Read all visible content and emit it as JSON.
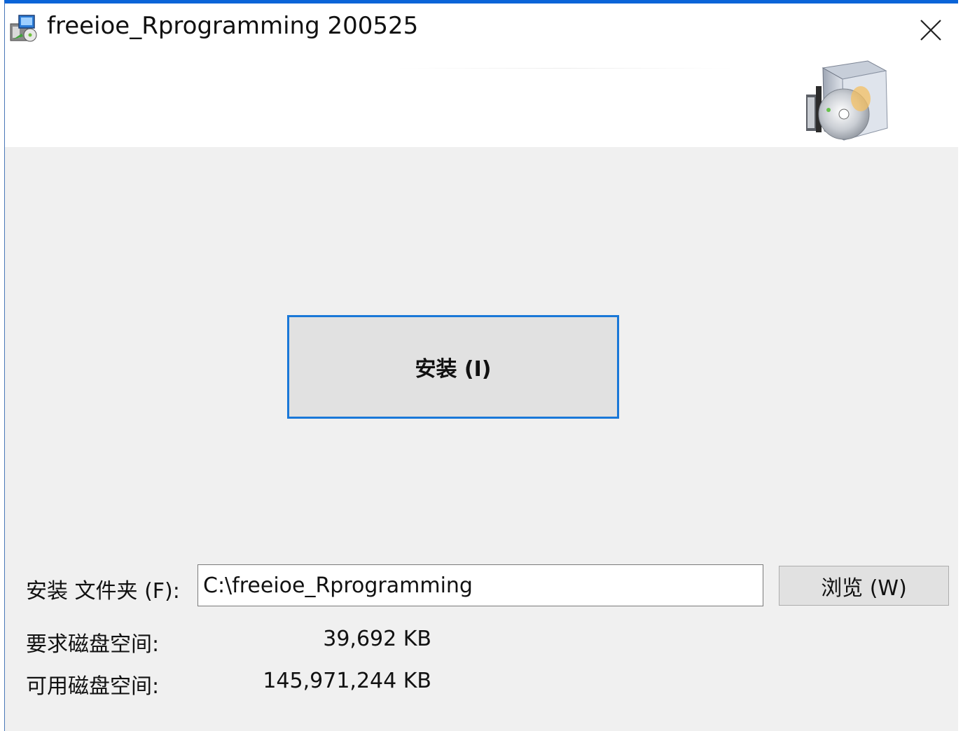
{
  "window": {
    "title": "freeioe_Rprogramming 200525",
    "app_icon": "installer-package-icon",
    "close_icon": "close-icon",
    "banner_image": "software-box-cd-icon"
  },
  "main": {
    "install_button_label": "安装 (I)"
  },
  "footer": {
    "folder_label": "安装 文件夹 (F):",
    "folder_path": "C:\\freeioe_Rprogramming",
    "browse_label": "浏览 (W)",
    "required_label": "要求磁盘空间:",
    "required_value": "39,692 KB",
    "available_label": "可用磁盘空间:",
    "available_value": "145,971,244 KB"
  },
  "colors": {
    "accent": "#1a78d8",
    "title_border": "#0a64d8",
    "panel_bg": "#f0f0f0",
    "button_bg": "#e1e1e1"
  }
}
